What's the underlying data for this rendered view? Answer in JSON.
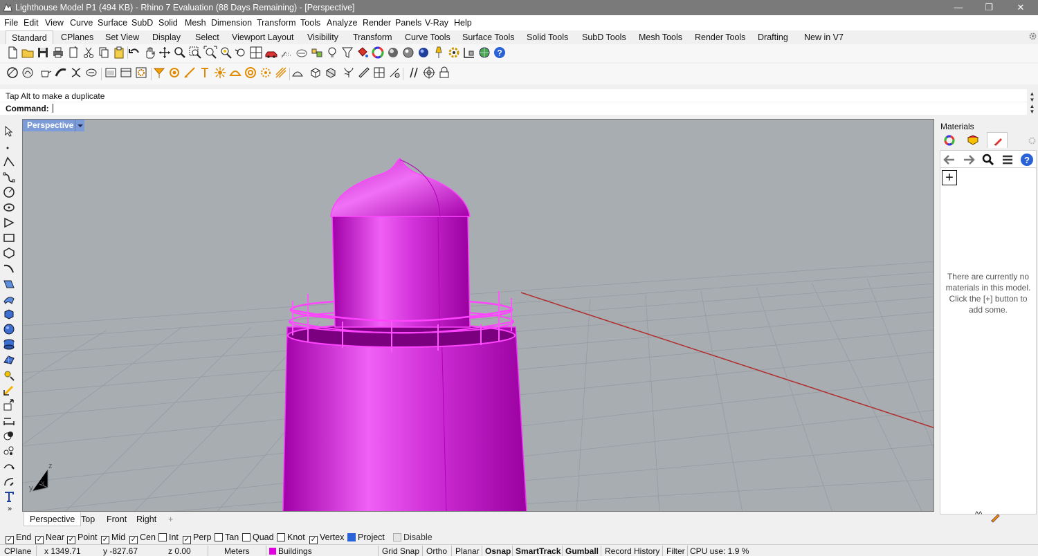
{
  "window": {
    "title": "Lighthouse Model P1 (494 KB) - Rhino 7 Evaluation (88 Days Remaining) - [Perspective]",
    "controls": {
      "minimize": "—",
      "restore": "❐",
      "close": "✕"
    }
  },
  "menu": [
    "File",
    "Edit",
    "View",
    "Curve",
    "Surface",
    "SubD",
    "Solid",
    "Mesh",
    "Dimension",
    "Transform",
    "Tools",
    "Analyze",
    "Render",
    "Panels",
    "V-Ray",
    "Help"
  ],
  "toolbar_tabs": [
    "Standard",
    "CPlanes",
    "Set View",
    "Display",
    "Select",
    "Viewport Layout",
    "Visibility",
    "Transform",
    "Curve Tools",
    "Surface Tools",
    "Solid Tools",
    "SubD Tools",
    "Mesh Tools",
    "Render Tools",
    "Drafting",
    "New in V7"
  ],
  "active_toolbar_tab": "Standard",
  "command": {
    "history": "Tap Alt to make a duplicate",
    "label": "Command:",
    "value": ""
  },
  "viewport": {
    "name": "Perspective",
    "axis_labels": {
      "x": "x",
      "y": "y",
      "z": "z"
    },
    "object_color": "#e020e0",
    "x_axis_color": "#b03030",
    "background": "#a8adb2"
  },
  "view_tabs": [
    "Perspective",
    "Top",
    "Front",
    "Right"
  ],
  "add_view_tab": "+",
  "panel": {
    "title": "Materials",
    "empty_message": "There are currently no materials in this model. Click the [+] button to add some.",
    "add_button": "+",
    "collapse_arrows": "^^"
  },
  "osnaps": [
    {
      "label": "End",
      "checked": true
    },
    {
      "label": "Near",
      "checked": true
    },
    {
      "label": "Point",
      "checked": true
    },
    {
      "label": "Mid",
      "checked": true
    },
    {
      "label": "Cen",
      "checked": true
    },
    {
      "label": "Int",
      "checked": false
    },
    {
      "label": "Perp",
      "checked": true
    },
    {
      "label": "Tan",
      "checked": false
    },
    {
      "label": "Quad",
      "checked": false
    },
    {
      "label": "Knot",
      "checked": false
    },
    {
      "label": "Vertex",
      "checked": true
    }
  ],
  "osnap_extra": {
    "project": "Project",
    "disable": "Disable"
  },
  "status": {
    "cplane": "CPlane",
    "x": "x 1349.71",
    "y": "y -827.67",
    "z": "z 0.00",
    "units": "Meters",
    "layer": "Buildings",
    "layer_color": "#e000e0",
    "grid_snap": "Grid Snap",
    "ortho": "Ortho",
    "planar": "Planar",
    "osnap": "Osnap",
    "smarttrack": "SmartTrack",
    "gumball": "Gumball",
    "record_history": "Record History",
    "filter": "Filter",
    "cpu": "CPU use: 1.9 %"
  }
}
